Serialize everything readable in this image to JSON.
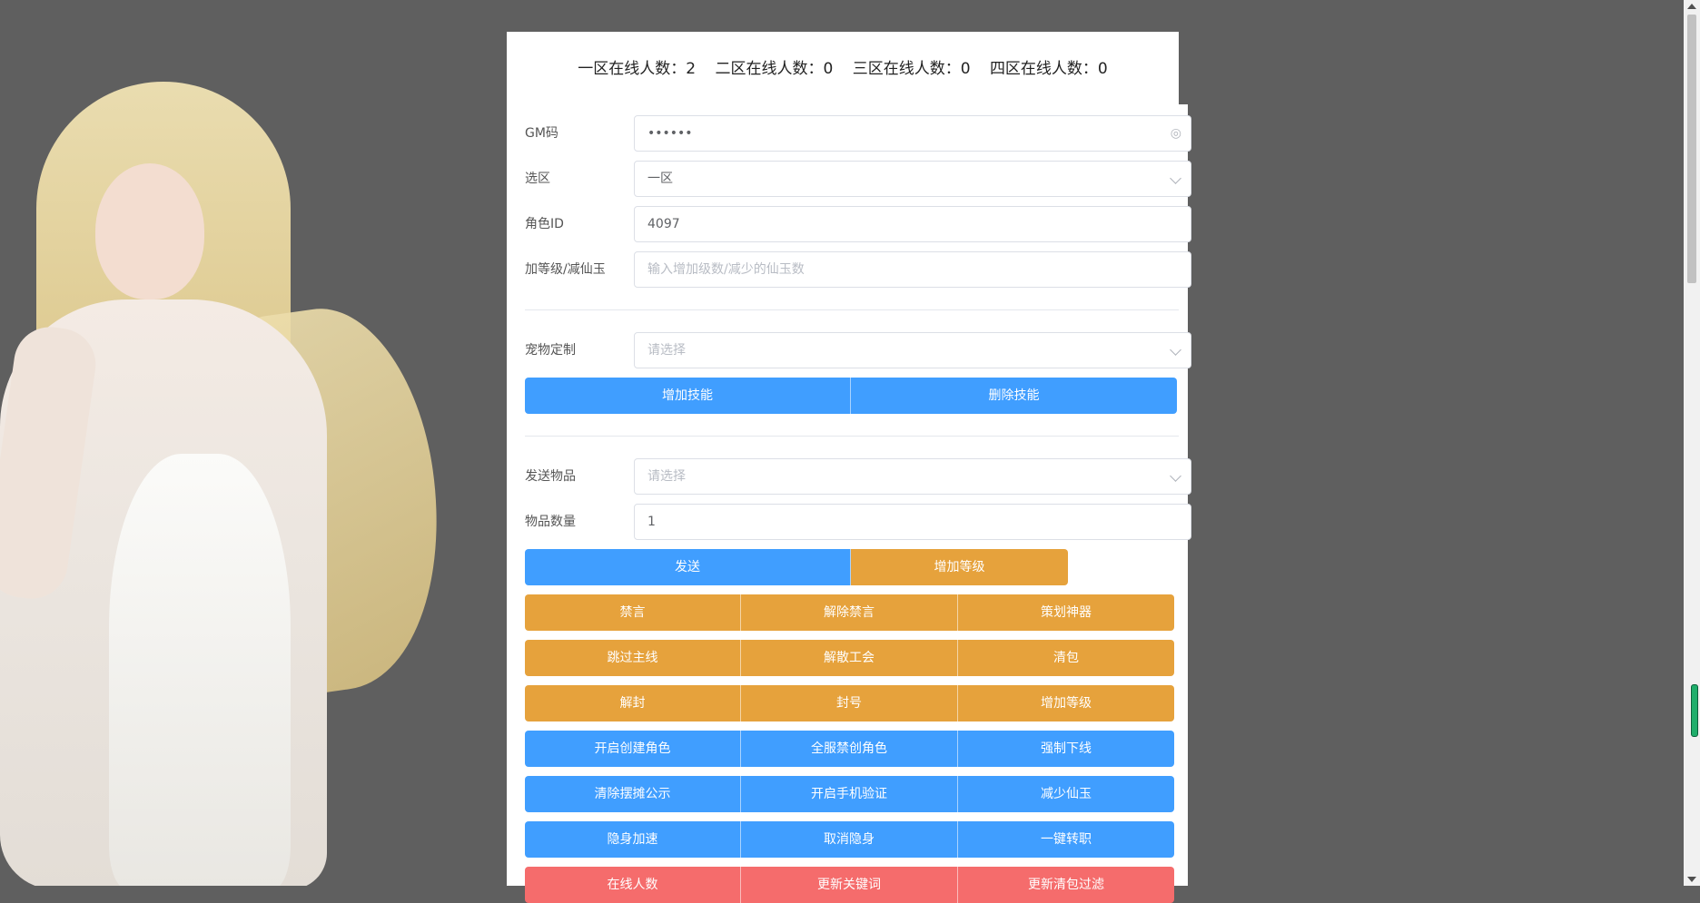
{
  "online": {
    "zone1": "一区在线人数：2",
    "zone2": "二区在线人数：0",
    "zone3": "三区在线人数：0",
    "zone4": "四区在线人数：0"
  },
  "form": {
    "gm_code": {
      "label": "GM码",
      "value": "••••••",
      "icon": "eye-icon"
    },
    "zone_select": {
      "label": "选区",
      "value": "一区"
    },
    "role_id": {
      "label": "角色ID",
      "value": "4097"
    },
    "level_jade": {
      "label": "加等级/减仙玉",
      "placeholder": "输入增加级数/减少的仙玉数"
    },
    "pet": {
      "label": "宠物定制",
      "placeholder": "请选择"
    },
    "item": {
      "label": "发送物品",
      "placeholder": "请选择"
    },
    "item_qty": {
      "label": "物品数量",
      "value": "1"
    }
  },
  "pet_buttons": [
    "增加技能",
    "删除技能"
  ],
  "send_buttons": [
    "发送",
    "增加等级"
  ],
  "action_rows": [
    {
      "color": "orange",
      "labels": [
        "禁言",
        "解除禁言",
        "策划神器"
      ]
    },
    {
      "color": "orange",
      "labels": [
        "跳过主线",
        "解散工会",
        "清包"
      ]
    },
    {
      "color": "orange",
      "labels": [
        "解封",
        "封号",
        "增加等级"
      ]
    },
    {
      "color": "blue",
      "labels": [
        "开启创建角色",
        "全服禁创角色",
        "强制下线"
      ]
    },
    {
      "color": "blue",
      "labels": [
        "清除摆摊公示",
        "开启手机验证",
        "减少仙玉"
      ]
    },
    {
      "color": "blue",
      "labels": [
        "隐身加速",
        "取消隐身",
        "一键转职"
      ]
    },
    {
      "color": "red",
      "labels": [
        "在线人数",
        "更新关键词",
        "更新清包过滤"
      ]
    }
  ],
  "colors": {
    "blue": "#409eff",
    "orange": "#e6a23c",
    "red": "#f56c6c",
    "background": "#5f5f5f"
  }
}
